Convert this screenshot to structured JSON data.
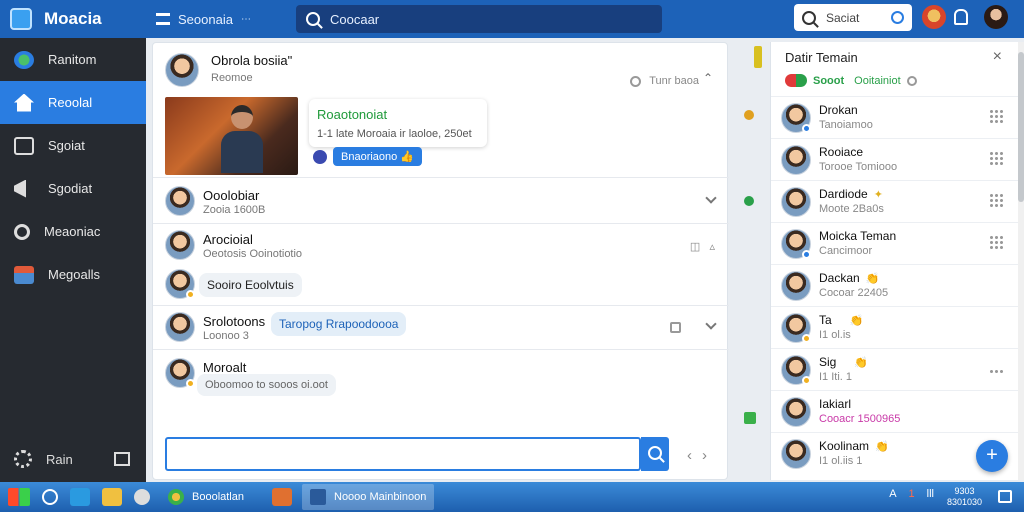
{
  "app": {
    "name": "Moacia"
  },
  "topbar": {
    "section_label": "Seoonaia",
    "search_placeholder": "Coocaar",
    "right_search_placeholder": "Saciat"
  },
  "sidebar": {
    "items": [
      {
        "label": "Ranitom",
        "icon": "globe-icon",
        "active": false
      },
      {
        "label": "Reoolal",
        "icon": "home-icon",
        "active": true
      },
      {
        "label": "Sgoiat",
        "icon": "layout-icon",
        "active": false
      },
      {
        "label": "Sgodiat",
        "icon": "megaphone-icon",
        "active": false
      },
      {
        "label": "Meaoniac",
        "icon": "search-person-icon",
        "active": false
      },
      {
        "label": "Megoalls",
        "icon": "contacts-icon",
        "active": false
      }
    ],
    "bottom_label": "Rain"
  },
  "post": {
    "author": "Obrola bosiia\"",
    "subtitle": "Reomoe",
    "meta": "Tunr baoa",
    "link_title": "Roaotonoiat",
    "link_sub": "1-1 late Moroaia ir laoloe, 250et",
    "pill_label": "Bnaoriaono"
  },
  "feed": [
    {
      "name": "Ooolobiar",
      "sub": "Zooia 1600B"
    },
    {
      "name": "Arocioial",
      "sub": "Oeotosis Ooinotiotio"
    },
    {
      "name": "",
      "sub": "",
      "bubble": "Sooiro Eoolvtuis"
    },
    {
      "name": "Srolotoons",
      "sub": "Loonoo 3",
      "bubble": "Taropog Rrapoodoooa"
    },
    {
      "name": "Moroalt",
      "sub": "",
      "bubble": "Oboomoo to sooos oi.oot"
    }
  ],
  "right_panel": {
    "title": "Datir Temain",
    "status": "Sooot",
    "status_detail": "Ooitainiot",
    "contacts": [
      {
        "name": "Drokan",
        "sub": "Tanoiamoo"
      },
      {
        "name": "Rooiace",
        "sub": "Torooe Tomiooo"
      },
      {
        "name": "Dardiode",
        "sub": "Moote 2Ba0s"
      },
      {
        "name": "Moicka Teman",
        "sub": "Cancimoor"
      },
      {
        "name": "Dackan",
        "sub": "Cocoar 22405"
      },
      {
        "name": "Ta",
        "sub": "I1 ol.is"
      },
      {
        "name": "Sig",
        "sub": "I1 Iti. 1"
      },
      {
        "name": "Iakiarl",
        "sub": "Cooacr 1500965"
      },
      {
        "name": "Koolinam",
        "sub": "I1 ol.iis 1"
      }
    ]
  },
  "taskbar": {
    "tasks": [
      "Booolatlan",
      "Noooo Mainbinoon"
    ],
    "tray": [
      "A",
      "1",
      "lll"
    ],
    "clock_line1": "9303",
    "clock_line2": "8301030"
  },
  "colors": {
    "accent": "#2a7de1",
    "topbar": "#1d62b8",
    "sidebar": "#262a30",
    "online": "#2aa04a"
  }
}
